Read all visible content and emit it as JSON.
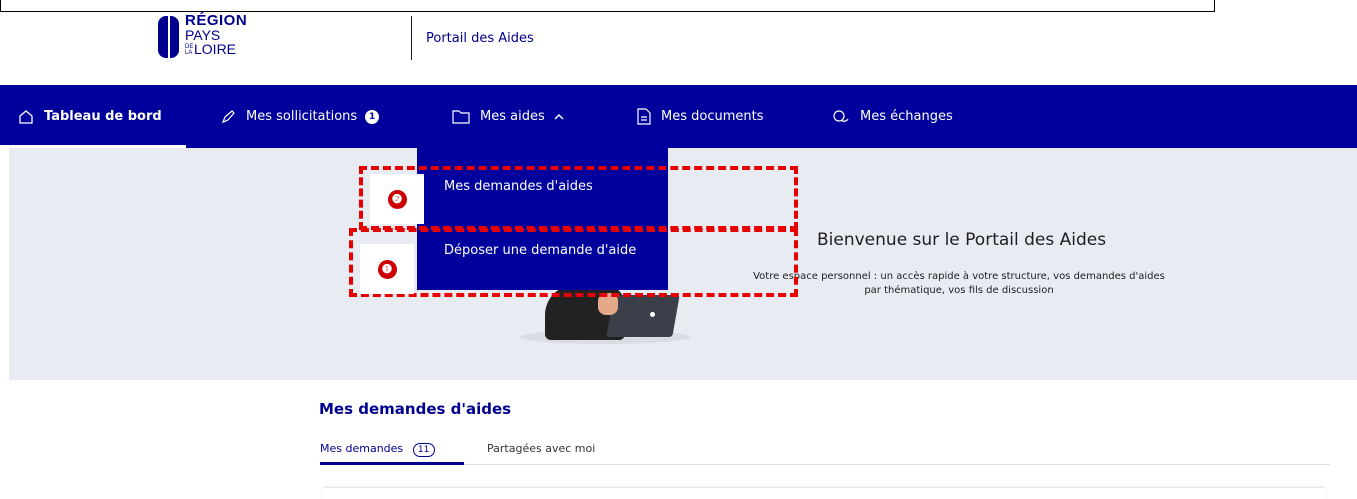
{
  "header": {
    "logo": {
      "line1": "RÉGION",
      "line2": "PAYS",
      "line3": "LOIRE",
      "small": "DE LA"
    },
    "portal_title": "Portail des Aides"
  },
  "nav": {
    "items": [
      {
        "label": "Tableau de bord",
        "icon": "home-icon",
        "active": true
      },
      {
        "label": "Mes sollicitations",
        "icon": "pen-icon",
        "badge": "1"
      },
      {
        "label": "Mes aides",
        "icon": "folder-icon",
        "chevron": "^"
      },
      {
        "label": "Mes documents",
        "icon": "document-icon"
      },
      {
        "label": "Mes échanges",
        "icon": "chat-icon"
      }
    ]
  },
  "dropdown": {
    "items": [
      {
        "label": "Mes demandes d'aides"
      },
      {
        "label": "Déposer une demande d'aide"
      }
    ]
  },
  "annotations": {
    "marker_top": "❷",
    "marker_bottom": "❶",
    "color": "#e60000"
  },
  "hero": {
    "title": "Bienvenue sur le Portail des Aides",
    "text": "Votre espace personnel : un accès rapide à votre structure, vos demandes d'aides par thématique, vos fils de discussion"
  },
  "section": {
    "title": "Mes demandes d'aides",
    "tabs": [
      {
        "label": "Mes demandes",
        "count": "11"
      },
      {
        "label": "Partagées avec moi"
      }
    ]
  },
  "colors": {
    "brand": "#00009c",
    "hero_bg": "#e9ebf3"
  }
}
